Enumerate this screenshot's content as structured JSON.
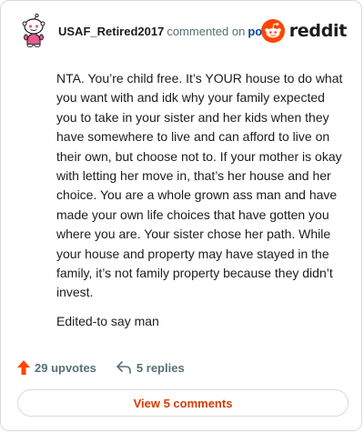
{
  "header": {
    "username": "USAF_Retired2017",
    "action_text": "commented on",
    "post_link_label": "post",
    "logo_text": "reddit"
  },
  "comment": {
    "paragraphs": [
      "NTA. You’re child free. It’s YOUR house to do what you want with and idk why your family expected you to take in your sister and her kids when they have somewhere to live and can afford to live on their own, but choose not to. If your mother is okay with letting her move in, that’s her house and her choice. You are a whole grown ass man and have made your own life choices that have gotten you where you are. Your sister chose her path. While your house and property may have stayed in the family, it’s not family property because they didn’t invest.",
      "Edited-to say man"
    ]
  },
  "actions": {
    "upvotes_label": "29 upvotes",
    "replies_label": "5 replies",
    "view_comments_label": "View 5 comments"
  },
  "colors": {
    "accent_orange": "#ff4500",
    "view_comments_text": "#d93a00",
    "link_blue": "#0a449b",
    "muted_gray": "#576f76",
    "avatar_pink": "#e25b8d"
  },
  "icons": {
    "avatar": "snoo-avatar-icon",
    "logo": "reddit-logo-icon",
    "upvote": "upvote-arrow-icon",
    "reply": "reply-arrow-icon"
  }
}
